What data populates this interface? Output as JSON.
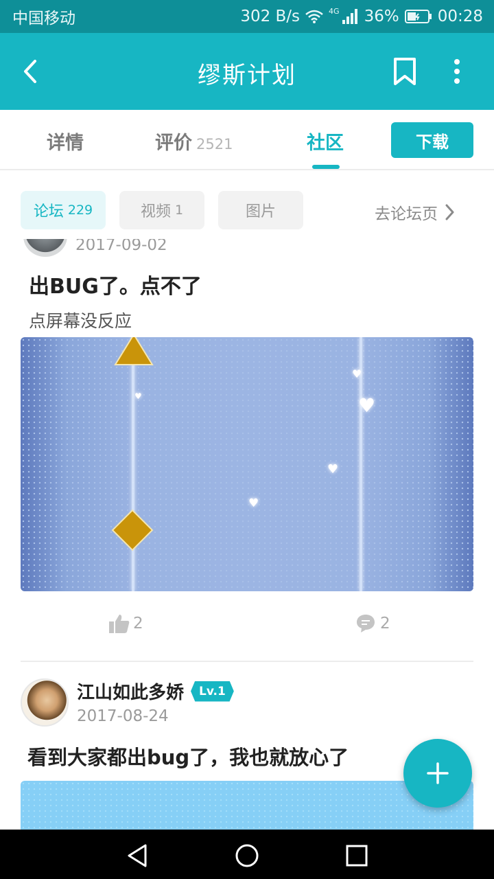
{
  "status_bar": {
    "carrier": "中国移动",
    "speed": "302 B/s",
    "network_type": "4G",
    "battery": "36%",
    "time": "00:28"
  },
  "app_bar": {
    "title": "缪斯计划"
  },
  "tabs": {
    "detail": "详情",
    "review": "评价",
    "review_count": "2521",
    "community": "社区",
    "download": "下载"
  },
  "filters": {
    "forum": "论坛",
    "forum_count": "229",
    "video": "视频",
    "video_count": "1",
    "photo": "图片",
    "goto_forum": "去论坛页"
  },
  "posts": [
    {
      "date": "2017-09-02",
      "title": "出BUG了。点不了",
      "body": "点屏幕没反应",
      "likes": "2",
      "comments": "2"
    },
    {
      "author": "江山如此多娇",
      "level": "Lv.1",
      "date": "2017-08-24",
      "title": "看到大家都出bug了，我也就放心了"
    }
  ],
  "colors": {
    "accent": "#17b6c3",
    "status_bar": "#0e8f98"
  }
}
